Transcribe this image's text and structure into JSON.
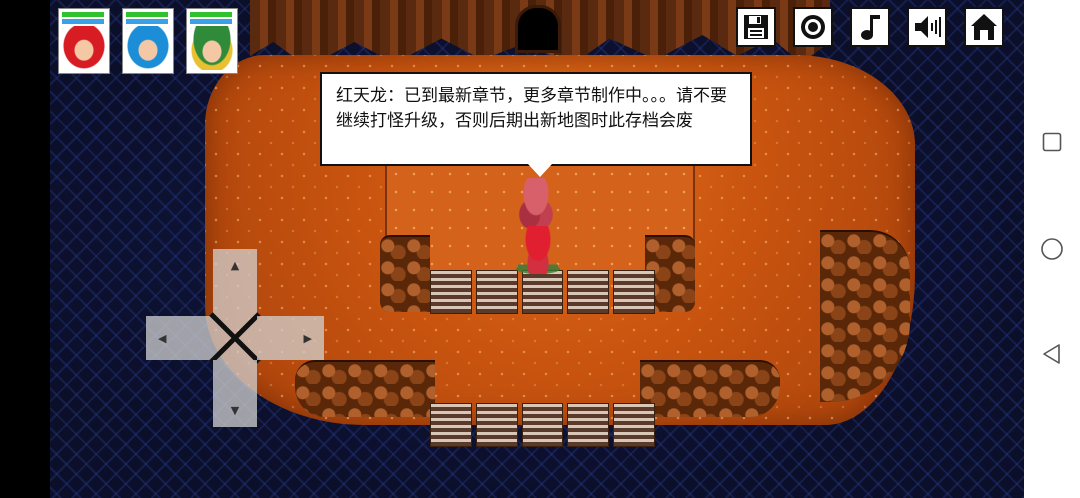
{
  "dialog": {
    "speaker": "红天龙",
    "text": "红天龙：已到最新章节，更多章节制作中。。。请不要继续打怪升级，否则后期出新地图时此存档会废"
  },
  "party": [
    {
      "portrait": "red-haired-hero",
      "hp_fraction": 1.0,
      "mp_fraction": 1.0,
      "hp_color": "#2ec22e",
      "mp_color": "#3aa0e8"
    },
    {
      "portrait": "blue-haired-girl",
      "hp_fraction": 1.0,
      "mp_fraction": 1.0,
      "hp_color": "#2ec22e",
      "mp_color": "#3aa0e8"
    },
    {
      "portrait": "green-hat-girl",
      "hp_fraction": 1.0,
      "mp_fraction": 1.0,
      "hp_color": "#2ec22e",
      "mp_color": "#3aa0e8"
    }
  ],
  "toolbar": [
    {
      "icon": "save-icon"
    },
    {
      "icon": "record-icon"
    },
    {
      "icon": "music-note-icon"
    },
    {
      "icon": "speaker-icon"
    },
    {
      "icon": "home-icon"
    }
  ],
  "dpad": {
    "up": "▲",
    "down": "▼",
    "left": "◀",
    "right": "▶"
  },
  "colors": {
    "lava": "#d5621a",
    "water": "#0b0f2a",
    "rock": "#5a2808",
    "dialog_bg": "#ffffff"
  }
}
